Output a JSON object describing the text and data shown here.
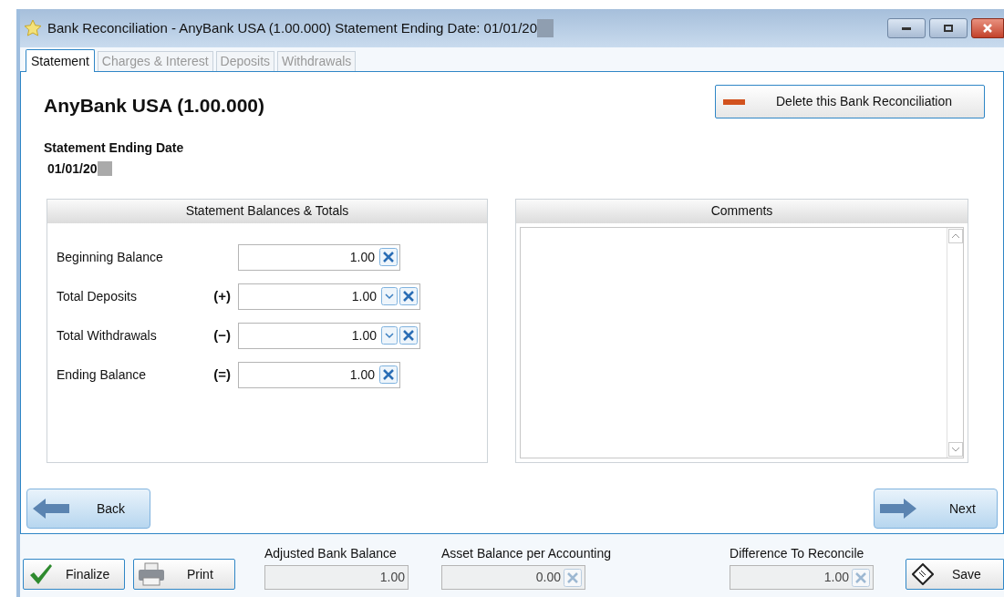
{
  "window": {
    "title": "Bank Reconciliation - AnyBank USA (1.00.000) Statement Ending Date: 01/01/20"
  },
  "tabs": [
    {
      "label": "Statement",
      "selected": true
    },
    {
      "label": "Charges & Interest",
      "selected": false
    },
    {
      "label": "Deposits",
      "selected": false
    },
    {
      "label": "Withdrawals",
      "selected": false
    }
  ],
  "account_heading": "AnyBank USA (1.00.000)",
  "delete_button": "Delete this Bank Reconciliation",
  "statement_date": {
    "label": "Statement Ending Date",
    "value": "01/01/20"
  },
  "balances": {
    "title": "Statement Balances & Totals",
    "rows": [
      {
        "label": "Beginning Balance",
        "value": "1.00",
        "dropdown": false
      },
      {
        "label": "Total Deposits",
        "sign": "(+)",
        "value": "1.00",
        "dropdown": true
      },
      {
        "label": "Total Withdrawals",
        "sign": "(−)",
        "value": "1.00",
        "dropdown": true
      },
      {
        "label": "Ending Balance",
        "sign": "(=)",
        "value": "1.00",
        "dropdown": false
      }
    ]
  },
  "comments": {
    "title": "Comments"
  },
  "nav": {
    "back": "Back",
    "next": "Next"
  },
  "footer": {
    "finalize": "Finalize",
    "print": "Print",
    "save": "Save",
    "totals": [
      {
        "label": "Adjusted Bank Balance",
        "value": "1.00",
        "clearable": false
      },
      {
        "label": "Asset Balance per Accounting",
        "value": "0.00",
        "clearable": true
      },
      {
        "label": "Difference To Reconcile",
        "value": "1.00",
        "clearable": true
      }
    ]
  }
}
